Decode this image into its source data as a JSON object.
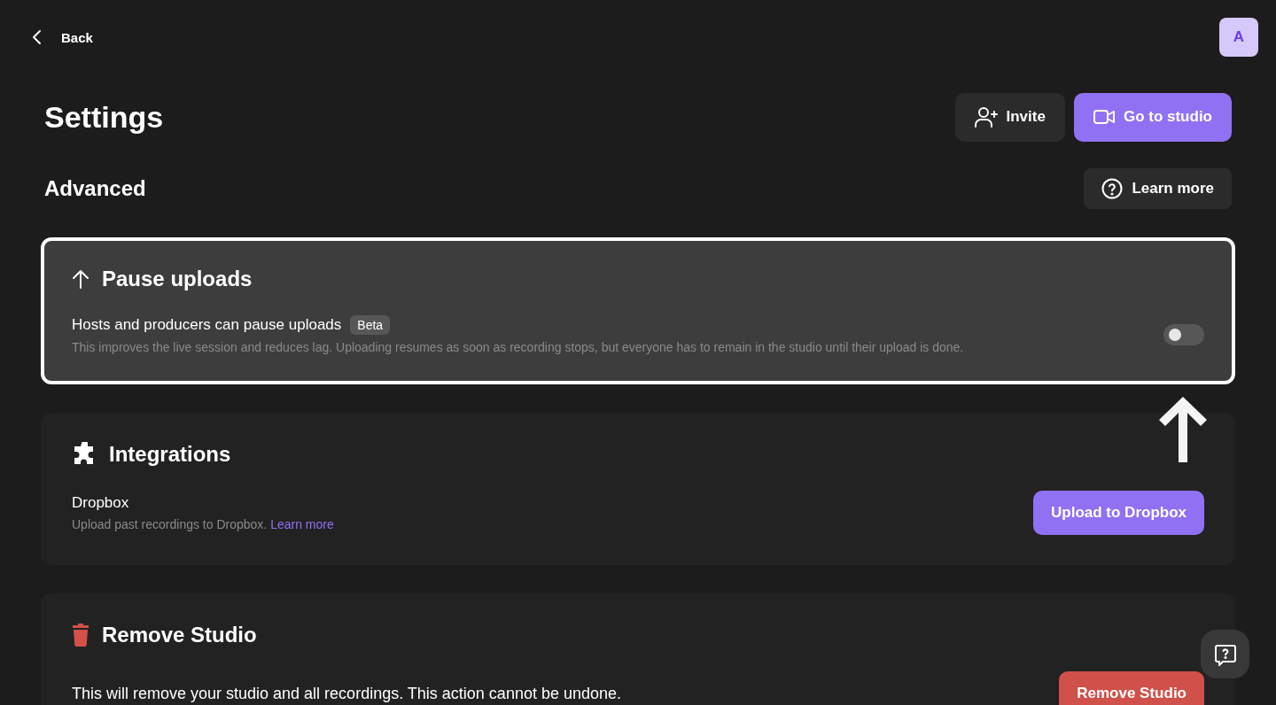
{
  "header": {
    "back_label": "Back",
    "avatar": "A"
  },
  "title": "Settings",
  "actions": [
    {
      "label": "Invite",
      "kind": "secondary"
    },
    {
      "label": "Go to studio",
      "kind": "primary"
    }
  ],
  "section": {
    "title": "Advanced",
    "help_label": "Learn more"
  },
  "cards": [
    {
      "title": "Pause uploads",
      "highlighted": true,
      "rows": [
        {
          "kind": "toggle",
          "label": "Hosts and producers can pause uploads",
          "badge": "Beta",
          "description": "This improves the live session and reduces lag. Uploading resumes as soon as recording stops, but everyone has to remain in the studio until their upload is done.",
          "on": false
        }
      ]
    },
    {
      "title": "Integrations",
      "highlighted": false,
      "rows": [
        {
          "kind": "button",
          "label": "Dropbox",
          "description": "Upload past recordings to Dropbox.",
          "link": "Learn more",
          "button": {
            "label": "Upload to Dropbox",
            "kind": "primary"
          }
        }
      ]
    },
    {
      "title": "Remove Studio",
      "highlighted": false,
      "rows": [
        {
          "kind": "button",
          "label": "This will remove your studio and all recordings. This action cannot be undone.",
          "button": {
            "label": "Remove Studio",
            "kind": "danger"
          }
        }
      ]
    }
  ]
}
